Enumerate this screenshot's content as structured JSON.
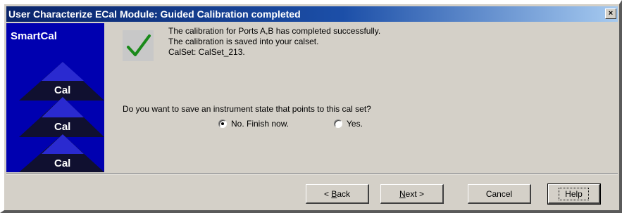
{
  "window": {
    "title": "User Characterize ECal Module: Guided Calibration completed",
    "close_glyph": "×"
  },
  "side_panel": {
    "title": "SmartCal",
    "art_labels": [
      "Cal",
      "Cal",
      "Cal"
    ]
  },
  "message": {
    "icon": "checkmark-icon",
    "lines": [
      "The calibration for Ports A,B has completed successfully.",
      "The calibration is saved into your calset.",
      "CalSet: CalSet_213."
    ]
  },
  "question": {
    "text": "Do you want to save an instrument state that points to this cal set?",
    "options": [
      {
        "label": "No.  Finish now.",
        "selected": true
      },
      {
        "label": "Yes.",
        "selected": false
      }
    ]
  },
  "buttons": {
    "back": {
      "prefix": "< ",
      "mnemonic": "B",
      "rest": "ack"
    },
    "next": {
      "mnemonic": "N",
      "rest": "ext >"
    },
    "cancel": {
      "label": "Cancel"
    },
    "help": {
      "label": "Help"
    }
  },
  "colors": {
    "titlebar": "#0a246a",
    "side_panel": "#0000b0",
    "check": "#1a8a1a",
    "face": "#d4d0c8"
  }
}
